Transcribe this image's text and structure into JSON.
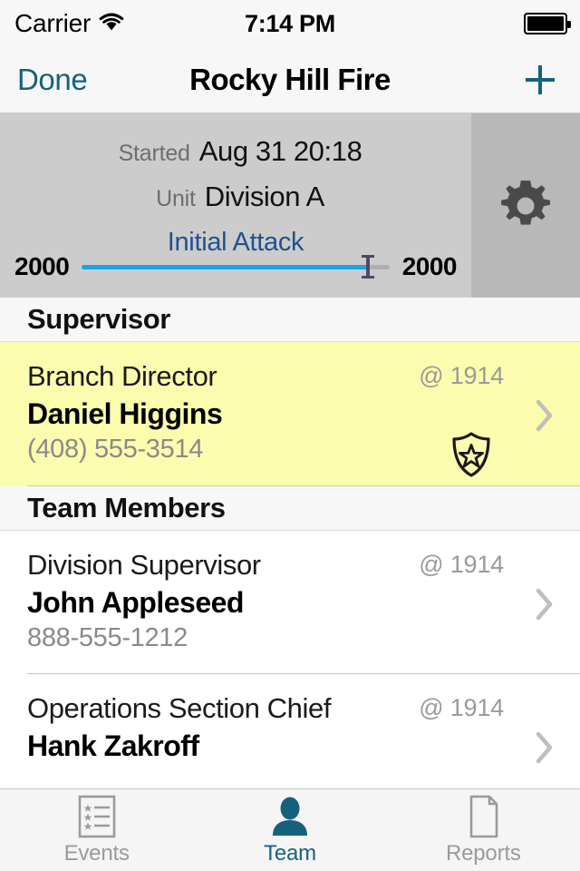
{
  "status_bar": {
    "carrier": "Carrier",
    "wifi_icon": "wifi-icon",
    "time": "7:14 PM",
    "battery_icon": "battery-full-icon"
  },
  "nav_bar": {
    "done_label": "Done",
    "title": "Rocky Hill Fire",
    "add_icon": "plus-icon",
    "accent_color": "#15627C"
  },
  "info_panel": {
    "started_label": "Started",
    "started_value": "Aug 31 20:18",
    "unit_label": "Unit",
    "unit_value": "Division A",
    "incident_type_link": "Initial Attack",
    "incident_type_color": "#21528E",
    "settings_icon": "gear-icon",
    "slider": {
      "left_value": "2000",
      "right_value": "2000",
      "fill_percent": 93,
      "fill_color": "#19A5E8"
    },
    "background_color": "#CCCCCC",
    "settings_background_color": "#B8B8B8"
  },
  "sections": [
    {
      "title": "Supervisor",
      "rows": [
        {
          "role": "Branch Director",
          "name": "Daniel Higgins",
          "phone": "(408) 555-3514",
          "time": "@ 1914",
          "highlighted": true,
          "highlight_color": "#FCFCAE",
          "badge_icon": "shield-star-icon",
          "chevron_icon": "chevron-right-icon"
        }
      ]
    },
    {
      "title": "Team Members",
      "rows": [
        {
          "role": "Division Supervisor",
          "name": "John Appleseed",
          "phone": "888-555-1212",
          "time": "@ 1914",
          "highlighted": false,
          "badge_icon": null,
          "chevron_icon": "chevron-right-icon"
        },
        {
          "role": "Operations Section Chief",
          "name": "Hank Zakroff",
          "phone": "",
          "time": "@ 1914",
          "highlighted": false,
          "badge_icon": null,
          "chevron_icon": "chevron-right-icon"
        }
      ]
    }
  ],
  "tab_bar": {
    "active_color": "#16627C",
    "inactive_color": "#9A9A9A",
    "tabs": [
      {
        "label": "Events",
        "icon": "checklist-star-icon",
        "active": false
      },
      {
        "label": "Team",
        "icon": "person-icon",
        "active": true
      },
      {
        "label": "Reports",
        "icon": "document-page-icon",
        "active": false
      }
    ]
  }
}
